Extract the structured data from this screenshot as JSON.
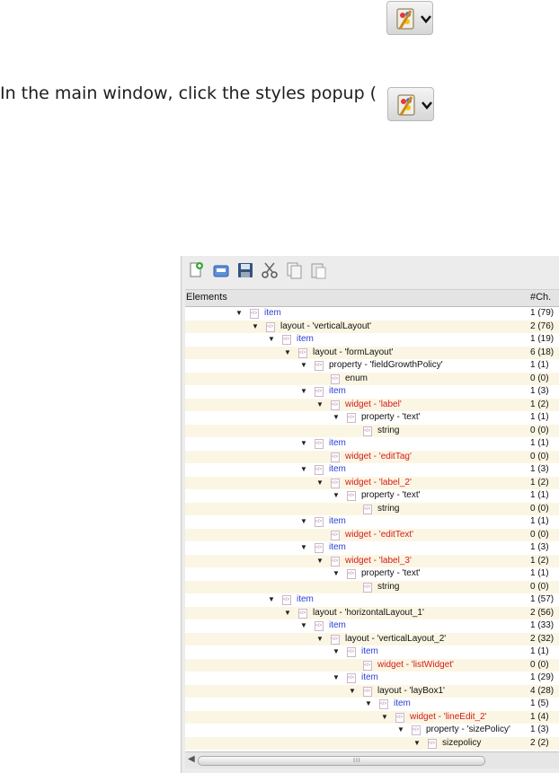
{
  "doc": {
    "instruction_text": "In the main window, click the styles popup ("
  },
  "editor": {
    "columns": {
      "elements": "Elements",
      "children": "#Ch."
    },
    "toolbar": [
      "new-document-icon",
      "open-icon",
      "save-icon",
      "cut-icon",
      "copy-icon",
      "paste-icon"
    ],
    "rows": [
      {
        "indent": 0,
        "arrow": true,
        "kind": "item",
        "label": "item",
        "color": "blue",
        "count": "1 (79)"
      },
      {
        "indent": 1,
        "arrow": true,
        "kind": "layout",
        "label": "layout - 'verticalLayout'",
        "color": "black",
        "count": "2 (76)"
      },
      {
        "indent": 2,
        "arrow": true,
        "kind": "item",
        "label": "item",
        "color": "blue",
        "count": "1 (19)"
      },
      {
        "indent": 3,
        "arrow": true,
        "kind": "layout",
        "label": "layout - 'formLayout'",
        "color": "black",
        "count": "6 (18)"
      },
      {
        "indent": 4,
        "arrow": true,
        "kind": "property",
        "label": "property - 'fieldGrowthPolicy'",
        "color": "black",
        "count": "1 (1)"
      },
      {
        "indent": 5,
        "arrow": false,
        "kind": "enum",
        "label": "enum",
        "color": "black",
        "count": "0 (0)"
      },
      {
        "indent": 4,
        "arrow": true,
        "kind": "item",
        "label": "item",
        "color": "blue",
        "count": "1 (3)"
      },
      {
        "indent": 5,
        "arrow": true,
        "kind": "widget",
        "label": "widget - 'label'",
        "color": "red",
        "count": "1 (2)"
      },
      {
        "indent": 6,
        "arrow": true,
        "kind": "property",
        "label": "property - 'text'",
        "color": "black",
        "count": "1 (1)"
      },
      {
        "indent": 7,
        "arrow": false,
        "kind": "string",
        "label": "string",
        "color": "black",
        "count": "0 (0)"
      },
      {
        "indent": 4,
        "arrow": true,
        "kind": "item",
        "label": "item",
        "color": "blue",
        "count": "1 (1)"
      },
      {
        "indent": 5,
        "arrow": false,
        "kind": "widget",
        "label": "widget - 'editTag'",
        "color": "red",
        "count": "0 (0)"
      },
      {
        "indent": 4,
        "arrow": true,
        "kind": "item",
        "label": "item",
        "color": "blue",
        "count": "1 (3)"
      },
      {
        "indent": 5,
        "arrow": true,
        "kind": "widget",
        "label": "widget - 'label_2'",
        "color": "red",
        "count": "1 (2)"
      },
      {
        "indent": 6,
        "arrow": true,
        "kind": "property",
        "label": "property - 'text'",
        "color": "black",
        "count": "1 (1)"
      },
      {
        "indent": 7,
        "arrow": false,
        "kind": "string",
        "label": "string",
        "color": "black",
        "count": "0 (0)"
      },
      {
        "indent": 4,
        "arrow": true,
        "kind": "item",
        "label": "item",
        "color": "blue",
        "count": "1 (1)"
      },
      {
        "indent": 5,
        "arrow": false,
        "kind": "widget",
        "label": "widget - 'editText'",
        "color": "red",
        "count": "0 (0)"
      },
      {
        "indent": 4,
        "arrow": true,
        "kind": "item",
        "label": "item",
        "color": "blue",
        "count": "1 (3)"
      },
      {
        "indent": 5,
        "arrow": true,
        "kind": "widget",
        "label": "widget - 'label_3'",
        "color": "red",
        "count": "1 (2)"
      },
      {
        "indent": 6,
        "arrow": true,
        "kind": "property",
        "label": "property - 'text'",
        "color": "black",
        "count": "1 (1)"
      },
      {
        "indent": 7,
        "arrow": false,
        "kind": "string",
        "label": "string",
        "color": "black",
        "count": "0 (0)"
      },
      {
        "indent": 2,
        "arrow": true,
        "kind": "item",
        "label": "item",
        "color": "blue",
        "count": "1 (57)"
      },
      {
        "indent": 3,
        "arrow": true,
        "kind": "layout",
        "label": "layout - 'horizontalLayout_1'",
        "color": "black",
        "count": "2 (56)"
      },
      {
        "indent": 4,
        "arrow": true,
        "kind": "item",
        "label": "item",
        "color": "blue",
        "count": "1 (33)"
      },
      {
        "indent": 5,
        "arrow": true,
        "kind": "layout",
        "label": "layout - 'verticalLayout_2'",
        "color": "black",
        "count": "2 (32)"
      },
      {
        "indent": 6,
        "arrow": true,
        "kind": "item",
        "label": "item",
        "color": "blue",
        "count": "1 (1)"
      },
      {
        "indent": 7,
        "arrow": false,
        "kind": "widget",
        "label": "widget - 'listWidget'",
        "color": "red",
        "count": "0 (0)"
      },
      {
        "indent": 6,
        "arrow": true,
        "kind": "item",
        "label": "item",
        "color": "blue",
        "count": "1 (29)"
      },
      {
        "indent": 7,
        "arrow": true,
        "kind": "layout",
        "label": "layout - 'layBox1'",
        "color": "black",
        "count": "4 (28)"
      },
      {
        "indent": 8,
        "arrow": true,
        "kind": "item",
        "label": "item",
        "color": "blue",
        "count": "1 (5)"
      },
      {
        "indent": 9,
        "arrow": true,
        "kind": "widget",
        "label": "widget - 'lineEdit_2'",
        "color": "red",
        "count": "1 (4)"
      },
      {
        "indent": 10,
        "arrow": true,
        "kind": "property",
        "label": "property - 'sizePolicy'",
        "color": "black",
        "count": "1 (3)"
      },
      {
        "indent": 11,
        "arrow": true,
        "kind": "sizepolicy",
        "label": "sizepolicy",
        "color": "black",
        "count": "2 (2)"
      }
    ],
    "scrollbar": {
      "grip": "III"
    }
  }
}
